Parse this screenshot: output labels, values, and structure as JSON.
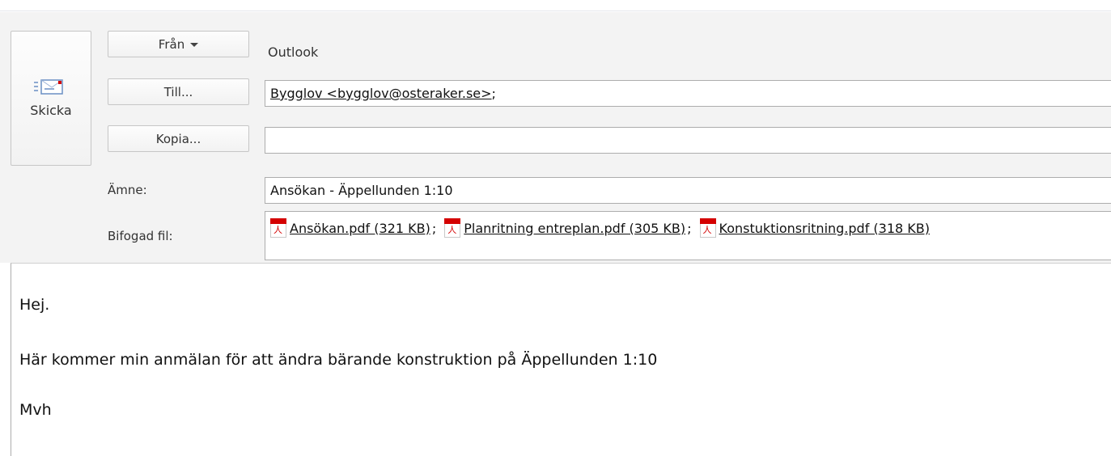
{
  "send_button": {
    "label": "Skicka",
    "icon": "envelope-send-icon"
  },
  "buttons": {
    "from": "Från",
    "to": "Till...",
    "cc": "Kopia..."
  },
  "from_value": "Outlook",
  "to_value": "Bygglov <bygglov@osteraker.se>",
  "to_separator": ";",
  "cc_value": "",
  "labels": {
    "subject": "Ämne:",
    "attachments": "Bifogad fil:"
  },
  "subject_value": "Ansökan - Äppellunden 1:10",
  "attachments": [
    {
      "name": "Ansökan.pdf (321 KB)",
      "icon": "pdf-icon"
    },
    {
      "name": "Planritning entreplan.pdf (305 KB)",
      "icon": "pdf-icon"
    },
    {
      "name": "Konstuktionsritning.pdf (318 KB)",
      "icon": "pdf-icon"
    }
  ],
  "attachment_separator": ";",
  "body_lines": [
    "Hej.",
    "Här kommer min anmälan för att ändra bärande konstruktion på Äppellunden 1:10",
    "Mvh"
  ],
  "colors": {
    "pdf_red": "#d40000",
    "header_bg": "#f3f3f3"
  }
}
